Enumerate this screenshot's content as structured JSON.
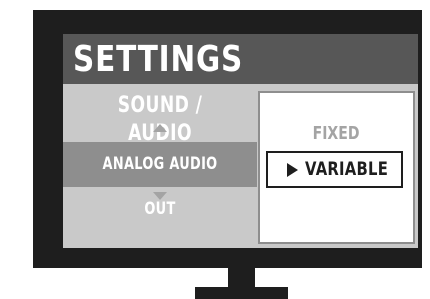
{
  "header": {
    "title": "SETTINGS"
  },
  "menu": {
    "category": "SOUND / AUDIO",
    "selected_item": "ANALOG AUDIO OUT"
  },
  "options": [
    {
      "label": "FIXED",
      "selected": false
    },
    {
      "label": "VARIABLE",
      "selected": true
    }
  ],
  "icons": {
    "up": "chevron-up-icon",
    "down": "chevron-down-icon",
    "selected_marker": "play-icon"
  },
  "colors": {
    "frame": "#1e1e1e",
    "header": "#575757",
    "panel": "#c9c9c9",
    "highlight": "#8e8e8e",
    "option_dim": "#a4a4a4"
  }
}
